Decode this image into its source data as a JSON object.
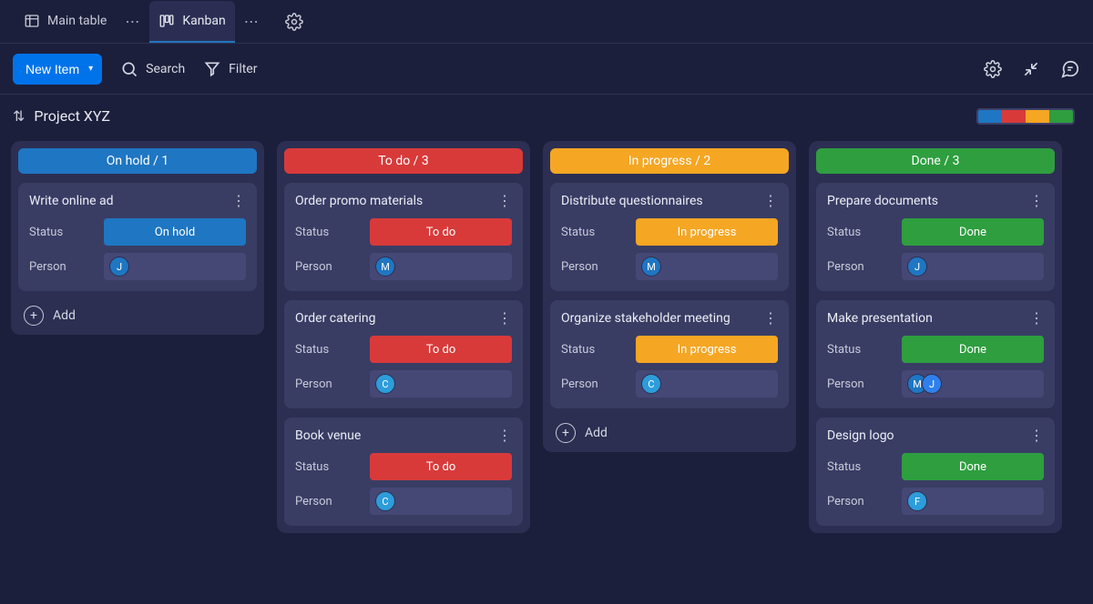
{
  "tabs": {
    "main_table": "Main table",
    "kanban": "Kanban"
  },
  "toolbar": {
    "new_item": "New Item",
    "search": "Search",
    "filter": "Filter"
  },
  "group": {
    "title": "Project XYZ"
  },
  "labels": {
    "status": "Status",
    "person": "Person",
    "add": "Add"
  },
  "statuses": {
    "on_hold": "On hold",
    "to_do": "To do",
    "in_progress": "In progress",
    "done": "Done"
  },
  "colors": {
    "on_hold": "#1F76C2",
    "to_do": "#D83A3A",
    "in_progress": "#F5A623",
    "done": "#2E9E3F"
  },
  "columns": [
    {
      "title": "On hold / 1",
      "color": "#1F76C2",
      "cards": [
        {
          "title": "Write online ad",
          "status": "On hold",
          "status_color": "#1F76C2",
          "people": [
            {
              "initial": "J",
              "color": "#1F76C2"
            }
          ]
        }
      ],
      "show_add": true
    },
    {
      "title": "To do / 3",
      "color": "#D83A3A",
      "cards": [
        {
          "title": "Order promo materials",
          "status": "To do",
          "status_color": "#D83A3A",
          "people": [
            {
              "initial": "M",
              "color": "#1F76C2"
            }
          ]
        },
        {
          "title": "Order catering",
          "status": "To do",
          "status_color": "#D83A3A",
          "people": [
            {
              "initial": "C",
              "color": "#2D9CDB"
            }
          ]
        },
        {
          "title": "Book venue",
          "status": "To do",
          "status_color": "#D83A3A",
          "people": [
            {
              "initial": "C",
              "color": "#2D9CDB"
            }
          ]
        }
      ],
      "show_add": false
    },
    {
      "title": "In progress / 2",
      "color": "#F5A623",
      "cards": [
        {
          "title": "Distribute questionnaires",
          "status": "In progress",
          "status_color": "#F5A623",
          "people": [
            {
              "initial": "M",
              "color": "#1F76C2"
            }
          ]
        },
        {
          "title": "Organize stakeholder meeting",
          "status": "In progress",
          "status_color": "#F5A623",
          "people": [
            {
              "initial": "C",
              "color": "#2D9CDB"
            }
          ]
        }
      ],
      "show_add": true
    },
    {
      "title": "Done / 3",
      "color": "#2E9E3F",
      "cards": [
        {
          "title": "Prepare documents",
          "status": "Done",
          "status_color": "#2E9E3F",
          "people": [
            {
              "initial": "J",
              "color": "#1F76C2"
            }
          ]
        },
        {
          "title": "Make presentation",
          "status": "Done",
          "status_color": "#2E9E3F",
          "people": [
            {
              "initial": "M",
              "color": "#1F76C2"
            },
            {
              "initial": "J",
              "color": "#2F80ED"
            }
          ]
        },
        {
          "title": "Design logo",
          "status": "Done",
          "status_color": "#2E9E3F",
          "people": [
            {
              "initial": "F",
              "color": "#2D9CDB"
            }
          ]
        }
      ],
      "show_add": false
    }
  ]
}
